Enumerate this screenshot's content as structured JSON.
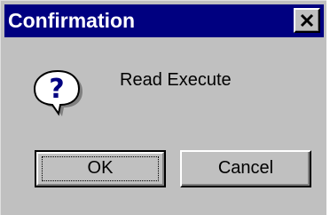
{
  "window": {
    "title": "Confirmation",
    "titlebar_color": "#000080",
    "face_color": "#c0c0c0"
  },
  "icons": {
    "close": "close-icon",
    "message": "question-icon"
  },
  "message": {
    "text": "Read Execute"
  },
  "buttons": {
    "ok_label": "OK",
    "cancel_label": "Cancel"
  }
}
